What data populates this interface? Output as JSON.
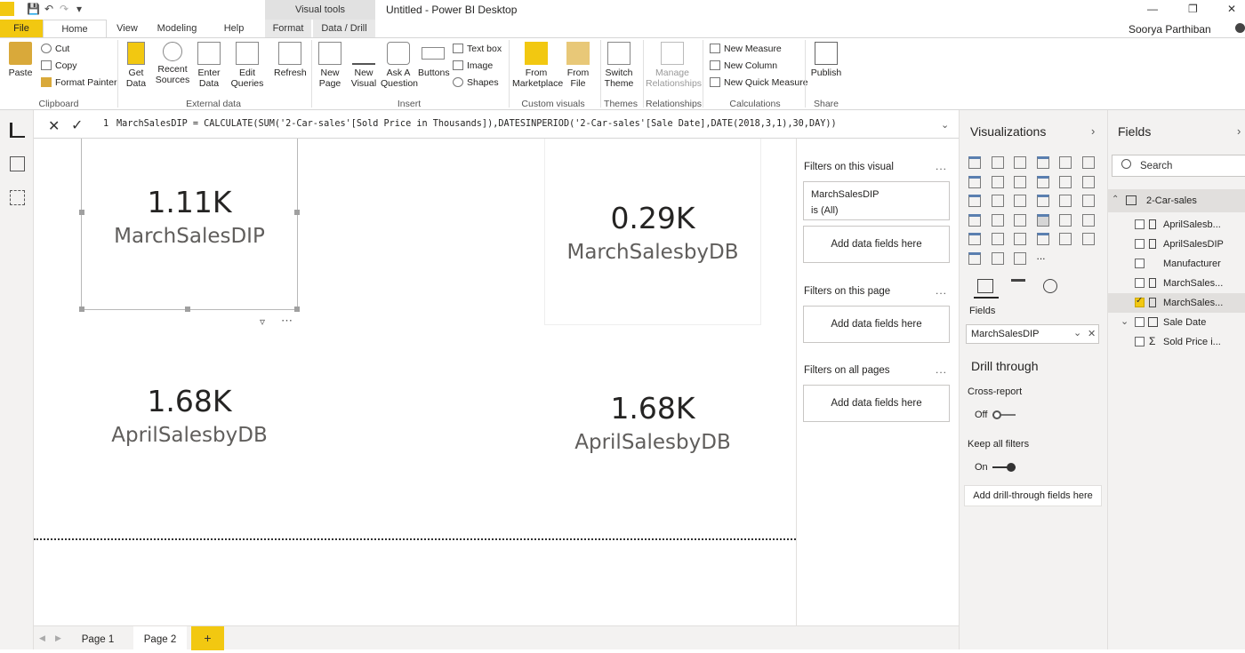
{
  "titlebar": {
    "app_title": "Untitled - Power BI Desktop",
    "context_tab": "Visual tools",
    "user": "Soorya Parthiban"
  },
  "tabs": [
    "File",
    "Home",
    "View",
    "Modeling",
    "Help",
    "Format",
    "Data / Drill"
  ],
  "ribbon": {
    "clipboard": {
      "paste": "Paste",
      "cut": "Cut",
      "copy": "Copy",
      "format_painter": "Format Painter",
      "label": "Clipboard"
    },
    "external": {
      "get_data": "Get\nData",
      "recent": "Recent\nSources",
      "enter": "Enter\nData",
      "edit": "Edit\nQueries",
      "refresh": "Refresh",
      "label": "External data"
    },
    "insert": {
      "new_page": "New\nPage",
      "new_visual": "New\nVisual",
      "ask": "Ask A\nQuestion",
      "buttons": "Buttons",
      "text_box": "Text box",
      "image": "Image",
      "shapes": "Shapes",
      "label": "Insert"
    },
    "custom": {
      "marketplace": "From\nMarketplace",
      "file": "From\nFile",
      "label": "Custom visuals"
    },
    "themes": {
      "switch": "Switch\nTheme",
      "label": "Themes"
    },
    "relationships": {
      "manage": "Manage\nRelationships",
      "label": "Relationships"
    },
    "calculations": {
      "measure": "New Measure",
      "column": "New Column",
      "quick": "New Quick Measure",
      "label": "Calculations"
    },
    "share": {
      "publish": "Publish",
      "label": "Share"
    }
  },
  "formula": {
    "line_number": "1",
    "text": "MarchSalesDIP = CALCULATE(SUM('2-Car-sales'[Sold Price in Thousands]),DATESINPERIOD('2-Car-sales'[Sale Date],DATE(2018,3,1),30,DAY))"
  },
  "cards": [
    {
      "value": "1.11K",
      "label": "MarchSalesDIP"
    },
    {
      "value": "0.29K",
      "label": "MarchSalesbyDB"
    },
    {
      "value": "1.68K",
      "label": "AprilSalesbyDB"
    },
    {
      "value": "1.68K",
      "label": "AprilSalesbyDB"
    }
  ],
  "pages": [
    "Page 1",
    "Page 2"
  ],
  "add_page": "+",
  "filters": {
    "visual_title": "Filters on this visual",
    "card_field": "MarchSalesDIP",
    "card_state": "is (All)",
    "add_fields": "Add data fields here",
    "page_title": "Filters on this page",
    "all_pages_title": "Filters on all pages",
    "dots": "..."
  },
  "visualizations": {
    "title": "Visualizations",
    "more": "...",
    "fields_label": "Fields",
    "field_chip": "MarchSalesDIP",
    "drill_through": "Drill through",
    "cross_report": "Cross-report",
    "off": "Off",
    "keep_filters": "Keep all filters",
    "on": "On",
    "add_drill": "Add drill-through fields here"
  },
  "fields_pane": {
    "title": "Fields",
    "search_placeholder": "Search",
    "table": "2-Car-sales",
    "items": [
      "AprilSalesb...",
      "AprilSalesDIP",
      "Manufacturer",
      "MarchSales...",
      "MarchSales...",
      "Sale Date",
      "Sold Price i..."
    ]
  },
  "colors": {
    "accent": "#f2c811",
    "pane_bg": "#f3f2f1",
    "selected_row": "#e1dfdd"
  }
}
